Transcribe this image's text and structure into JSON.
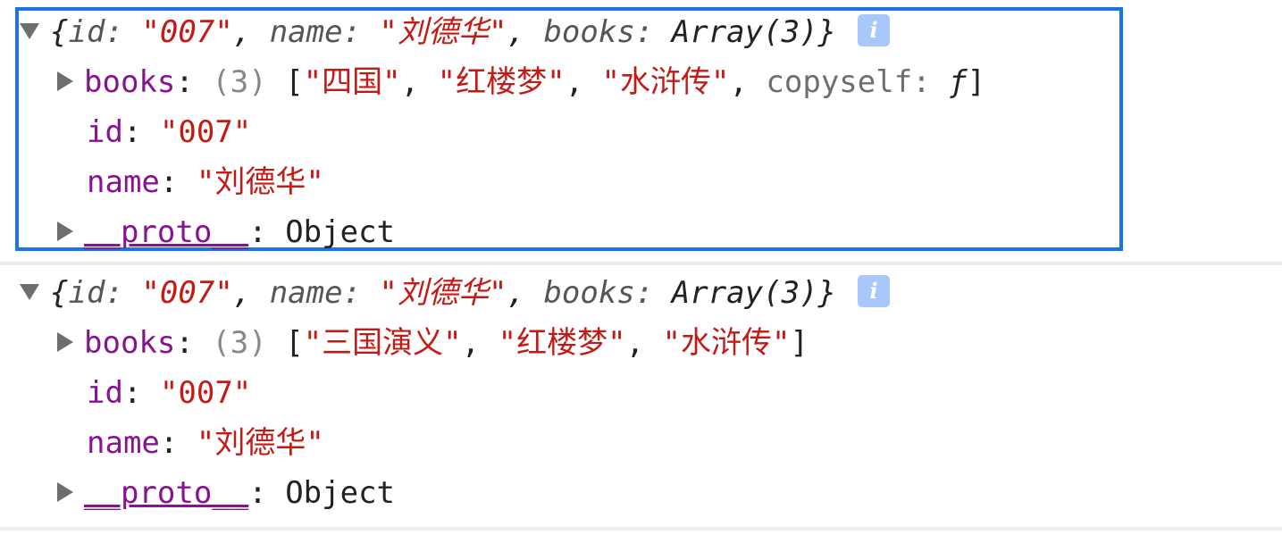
{
  "entries": [
    {
      "summary": {
        "open": "{",
        "id_key": "id",
        "id_value": "\"007\"",
        "name_key": "name",
        "name_value": "\"刘德华\"",
        "books_key": "books",
        "books_value": "Array(3)",
        "close": "}",
        "info_badge": "i"
      },
      "books_row": {
        "key": "books",
        "count": "(3)",
        "open": "[",
        "items": [
          "\"四国\"",
          "\"红楼梦\"",
          "\"水浒传\""
        ],
        "extra_key": "copyself",
        "extra_value": "ƒ",
        "close": "]"
      },
      "id_row": {
        "key": "id",
        "value": "\"007\""
      },
      "name_row": {
        "key": "name",
        "value": "\"刘德华\""
      },
      "proto_row": {
        "key": "__proto__",
        "value": "Object"
      }
    },
    {
      "summary": {
        "open": "{",
        "id_key": "id",
        "id_value": "\"007\"",
        "name_key": "name",
        "name_value": "\"刘德华\"",
        "books_key": "books",
        "books_value": "Array(3)",
        "close": "}",
        "info_badge": "i"
      },
      "books_row": {
        "key": "books",
        "count": "(3)",
        "open": "[",
        "items": [
          "\"三国演义\"",
          "\"红楼梦\"",
          "\"水浒传\""
        ],
        "close": "]"
      },
      "id_row": {
        "key": "id",
        "value": "\"007\""
      },
      "name_row": {
        "key": "name",
        "value": "\"刘德华\""
      },
      "proto_row": {
        "key": "__proto__",
        "value": "Object"
      }
    }
  ],
  "icons": {
    "expanded": "triangle-down-icon",
    "collapsed": "triangle-right-icon",
    "info": "info-icon"
  },
  "colors": {
    "selection_border": "#1a73e8",
    "key": "#881391",
    "string": "#c41a16",
    "info_badge_bg": "#a8c7fa"
  }
}
